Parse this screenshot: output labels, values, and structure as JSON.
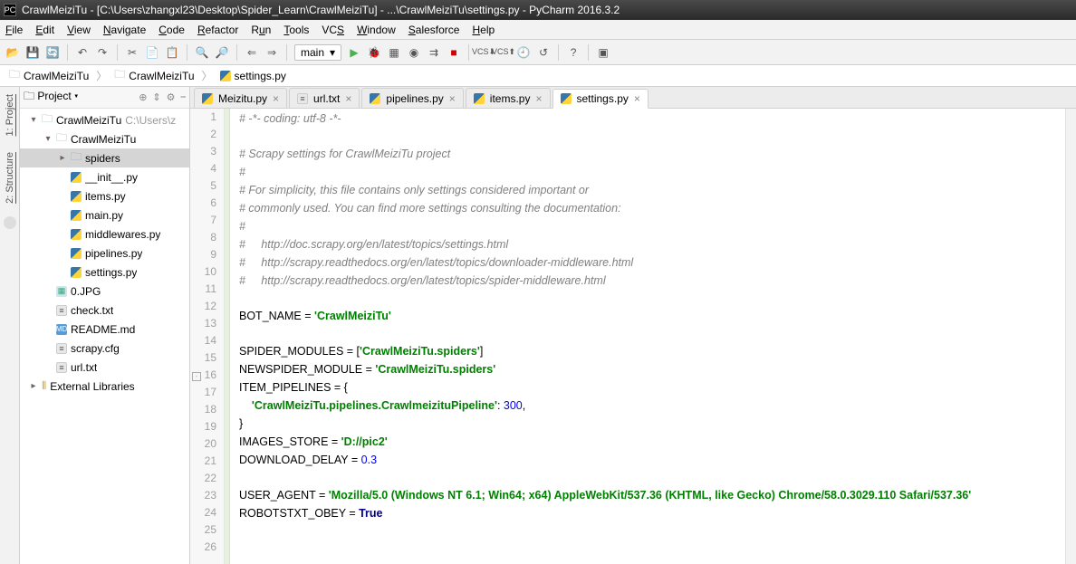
{
  "title": "CrawlMeiziTu - [C:\\Users\\zhangxl23\\Desktop\\Spider_Learn\\CrawlMeiziTu] - ...\\CrawlMeiziTu\\settings.py - PyCharm 2016.3.2",
  "menus": [
    "File",
    "Edit",
    "View",
    "Navigate",
    "Code",
    "Refactor",
    "Run",
    "Tools",
    "VCS",
    "Window",
    "Salesforce",
    "Help"
  ],
  "run_config": "main",
  "breadcrumbs": [
    {
      "icon": "folder",
      "label": "CrawlMeiziTu"
    },
    {
      "icon": "folder",
      "label": "CrawlMeiziTu"
    },
    {
      "icon": "py",
      "label": "settings.py"
    }
  ],
  "side_tabs": [
    "1: Project",
    "2: Structure"
  ],
  "project_head": {
    "title": "Project"
  },
  "tree": [
    {
      "depth": 0,
      "tw": "▾",
      "icon": "folder",
      "label": "CrawlMeiziTu",
      "suffix": "C:\\Users\\z"
    },
    {
      "depth": 1,
      "tw": "▾",
      "icon": "folder",
      "label": "CrawlMeiziTu"
    },
    {
      "depth": 2,
      "tw": "▸",
      "icon": "folder",
      "label": "spiders",
      "sel": true
    },
    {
      "depth": 2,
      "tw": "",
      "icon": "py",
      "label": "__init__.py"
    },
    {
      "depth": 2,
      "tw": "",
      "icon": "py",
      "label": "items.py"
    },
    {
      "depth": 2,
      "tw": "",
      "icon": "py",
      "label": "main.py"
    },
    {
      "depth": 2,
      "tw": "",
      "icon": "py",
      "label": "middlewares.py"
    },
    {
      "depth": 2,
      "tw": "",
      "icon": "py",
      "label": "pipelines.py"
    },
    {
      "depth": 2,
      "tw": "",
      "icon": "py",
      "label": "settings.py"
    },
    {
      "depth": 1,
      "tw": "",
      "icon": "jpg",
      "label": "0.JPG"
    },
    {
      "depth": 1,
      "tw": "",
      "icon": "txt",
      "label": "check.txt"
    },
    {
      "depth": 1,
      "tw": "",
      "icon": "md",
      "label": "README.md"
    },
    {
      "depth": 1,
      "tw": "",
      "icon": "txt",
      "label": "scrapy.cfg"
    },
    {
      "depth": 1,
      "tw": "",
      "icon": "txt",
      "label": "url.txt"
    },
    {
      "depth": 0,
      "tw": "▸",
      "icon": "lib",
      "label": "External Libraries"
    }
  ],
  "editor_tabs": [
    {
      "label": "Meizitu.py",
      "active": false
    },
    {
      "label": "url.txt",
      "active": false,
      "txt": true
    },
    {
      "label": "pipelines.py",
      "active": false
    },
    {
      "label": "items.py",
      "active": false
    },
    {
      "label": "settings.py",
      "active": true
    }
  ],
  "code": {
    "l1": "# -*- coding: utf-8 -*-",
    "l3": "# Scrapy settings for CrawlMeiziTu project",
    "l4": "#",
    "l5": "# For simplicity, this file contains only settings considered important or",
    "l6": "# commonly used. You can find more settings consulting the documentation:",
    "l7": "#",
    "l8": "#     http://doc.scrapy.org/en/latest/topics/settings.html",
    "l9": "#     http://scrapy.readthedocs.org/en/latest/topics/downloader-middleware.html",
    "l10": "#     http://scrapy.readthedocs.org/en/latest/topics/spider-middleware.html",
    "l12a": "BOT_NAME = ",
    "l12b": "'CrawlMeiziTu'",
    "l14a": "SPIDER_MODULES = [",
    "l14b": "'CrawlMeiziTu.spiders'",
    "l14c": "]",
    "l15a": "NEWSPIDER_MODULE = ",
    "l15b": "'CrawlMeiziTu.spiders'",
    "l16": "ITEM_PIPELINES = {",
    "l17a": "    ",
    "l17b": "'CrawlMeiziTu.pipelines.CrawlmeizituPipeline'",
    "l17c": ": ",
    "l17d": "300",
    "l17e": ",",
    "l18": "}",
    "l19a": "IMAGES_STORE = ",
    "l19b": "'D://pic2'",
    "l20a": "DOWNLOAD_DELAY = ",
    "l20b": "0.3",
    "l22a": "USER_AGENT = ",
    "l22b": "'Mozilla/5.0 (Windows NT 6.1; Win64; x64) AppleWebKit/537.36 (KHTML, like Gecko) Chrome/58.0.3029.110 Safari/537.36'",
    "l23a": "ROBOTSTXT_OBEY = ",
    "l23b": "True"
  }
}
